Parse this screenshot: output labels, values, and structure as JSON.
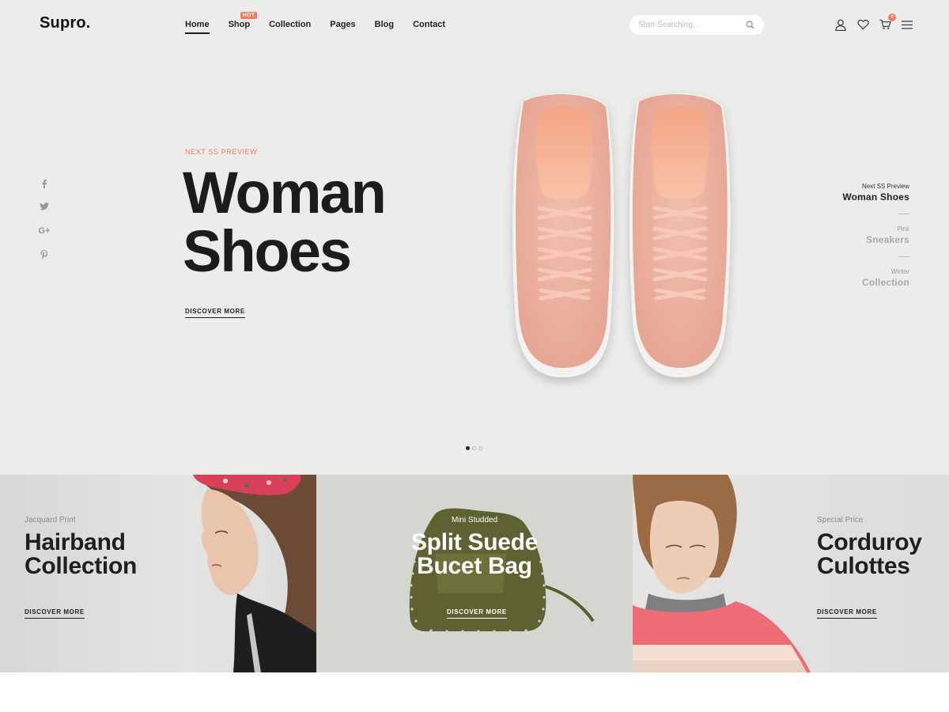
{
  "header": {
    "logo": "Supro.",
    "nav": [
      {
        "label": "Home",
        "active": true
      },
      {
        "label": "Shop",
        "badge": "HOT"
      },
      {
        "label": "Collection"
      },
      {
        "label": "Pages"
      },
      {
        "label": "Blog"
      },
      {
        "label": "Contact"
      }
    ],
    "search": {
      "placeholder": "Start Searching..."
    },
    "cart_count": "0",
    "accent_color": "#f07c5d"
  },
  "social": [
    "f",
    "twitter",
    "G+",
    "p"
  ],
  "hero": {
    "eyebrow": "NEXT SS PREVIEW",
    "title_line1": "Woman",
    "title_line2": "Shoes",
    "cta": "DISCOVER MORE"
  },
  "slides": [
    {
      "sub": "Next SS Preview",
      "name": "Woman Shoes",
      "active": true
    },
    {
      "sub": "Pink",
      "name": "Sneakers"
    },
    {
      "sub": "Winter",
      "name": "Collection"
    }
  ],
  "slider_active_index": 0,
  "banners": [
    {
      "sub": "Jacquard Print",
      "title_line1": "Hairband",
      "title_line2": "Collection",
      "cta": "DISCOVER MORE"
    },
    {
      "sub": "Mini Studded",
      "title_line1": "Split Suede",
      "title_line2": "Bucet Bag",
      "cta": "DISCOVER MORE"
    },
    {
      "sub": "Special Price",
      "title_line1": "Corduroy",
      "title_line2": "Culottes",
      "cta": "DISCOVER MORE"
    }
  ]
}
